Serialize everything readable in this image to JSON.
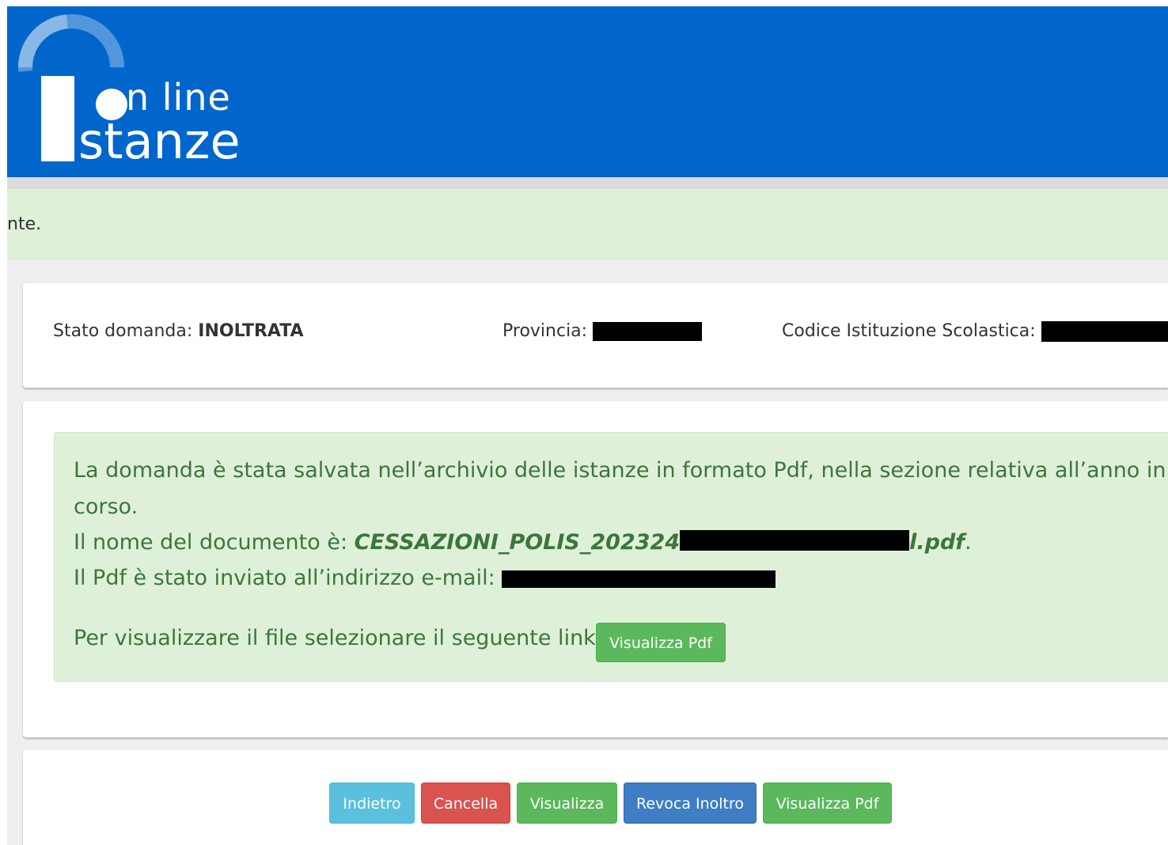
{
  "logo": {
    "online_text": "n line",
    "stanze_text": "stanze"
  },
  "top_alert": {
    "text": "nte."
  },
  "info": {
    "stato_label": "Stato domanda: ",
    "stato_value": "INOLTRATA",
    "provincia_label": "Provincia: ",
    "codice_label": "Codice Istituzione Scolastica: "
  },
  "message": {
    "line1": "La domanda è stata salvata nell’archivio delle istanze in formato Pdf, nella sezione relativa all’anno in",
    "line2": "corso.",
    "docname_label": "Il nome del documento è: ",
    "docname_prefix": "CESSAZIONI_POLIS_202324",
    "docname_suffix": "l.pdf",
    "docname_end": ".",
    "email_label": "Il Pdf è stato inviato all’indirizzo e-mail: ",
    "link_label": "Per visualizzare il file selezionare il seguente link: ",
    "link_button": "Visualizza Pdf"
  },
  "actions": {
    "indietro": "Indietro",
    "cancella": "Cancella",
    "visualizza": "Visualizza",
    "revoca": "Revoca Inoltro",
    "visualizza_pdf": "Visualizza Pdf"
  },
  "colors": {
    "header": "#0066cc",
    "success_bg": "#dff0d8",
    "success_text": "#3c763d",
    "btn_info": "#5bc0de",
    "btn_danger": "#d9534f",
    "btn_success": "#5cb85c",
    "btn_primary": "#3f7ec4"
  }
}
